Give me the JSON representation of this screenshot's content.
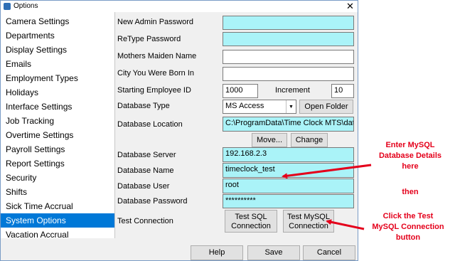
{
  "window": {
    "title": "Options"
  },
  "sidebar": {
    "items": [
      {
        "label": "Camera Settings"
      },
      {
        "label": "Departments"
      },
      {
        "label": "Display Settings"
      },
      {
        "label": "Emails"
      },
      {
        "label": "Employment Types"
      },
      {
        "label": "Holidays"
      },
      {
        "label": "Interface Settings"
      },
      {
        "label": "Job Tracking"
      },
      {
        "label": "Overtime Settings"
      },
      {
        "label": "Payroll Settings"
      },
      {
        "label": "Report Settings"
      },
      {
        "label": "Security"
      },
      {
        "label": "Shifts"
      },
      {
        "label": "Sick Time Accrual"
      },
      {
        "label": "System Options"
      },
      {
        "label": "Vacation Accrual"
      }
    ],
    "selected": "System Options"
  },
  "form": {
    "new_admin_password_label": "New Admin Password",
    "retype_password_label": "ReType Password",
    "mothers_maiden_name_label": "Mothers Maiden Name",
    "city_born_label": "City You Were Born In",
    "starting_employee_id_label": "Starting Employee ID",
    "starting_employee_id_value": "1000",
    "increment_label": "Increment",
    "increment_value": "10",
    "database_type_label": "Database Type",
    "database_type_value": "MS Access",
    "open_folder_label": "Open Folder",
    "database_location_label": "Database Location",
    "database_location_value": "C:\\ProgramData\\Time Clock MTS\\datab",
    "move_label": "Move...",
    "change_label": "Change",
    "database_server_label": "Database Server",
    "database_server_value": "192.168.2.3",
    "database_name_label": "Database Name",
    "database_name_value": "timeclock_test",
    "database_user_label": "Database User",
    "database_user_value": "root",
    "database_password_label": "Database Password",
    "database_password_value": "**********",
    "test_connection_label": "Test Connection",
    "test_sql_line1": "Test SQL",
    "test_sql_line2": "Connection",
    "test_mysql_line1": "Test MySQL",
    "test_mysql_line2": "Connection"
  },
  "footer": {
    "help_label": "Help",
    "save_label": "Save",
    "cancel_label": "Cancel"
  },
  "annotations": {
    "note1_line1": "Enter MySQL",
    "note1_line2": "Database Details",
    "note1_line3": "here",
    "note2": "then",
    "note3_line1": "Click the Test",
    "note3_line2": "MySQL Connection",
    "note3_line3": "button",
    "color": "#e4001b"
  },
  "colors": {
    "accent": "#0078d7",
    "field_highlight": "#aaf3f8"
  }
}
